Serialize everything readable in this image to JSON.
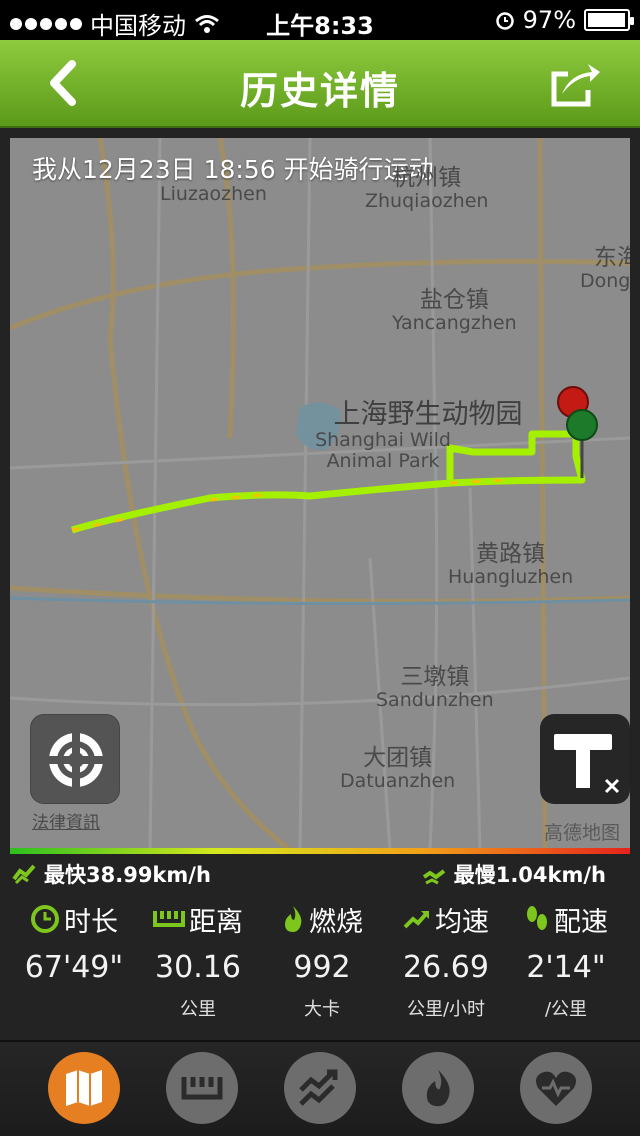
{
  "status_bar": {
    "carrier": "中国移动",
    "time": "上午8:33",
    "battery": "97%",
    "battery_level": 0.97
  },
  "nav": {
    "title": "历史详情",
    "back_icon": "chevron-left-icon",
    "share_icon": "share-icon"
  },
  "map": {
    "caption": "我从12月23日 18:56 开始骑行运动",
    "places": [
      {
        "zh": "",
        "en": "Liuzaozhen"
      },
      {
        "zh": "杭州镇",
        "en": "Zhuqiaozhen"
      },
      {
        "zh": "东海",
        "en": "Dongha"
      },
      {
        "zh": "盐仓镇",
        "en": "Yancangzhen"
      },
      {
        "zh": "上海野生动物园",
        "en": "Shanghai Wild Animal Park"
      },
      {
        "zh": "黄路镇",
        "en": "Huangluzhen"
      },
      {
        "zh": "三墩镇",
        "en": "Sandunzhen"
      },
      {
        "zh": "大团镇",
        "en": "Datuanzhen"
      }
    ],
    "legal_link": "法律資訊",
    "logo": "高德地图",
    "locate_icon": "locate-icon",
    "layer_icon": "toggle-track-icon"
  },
  "speed": {
    "fastest": "最快38.99km/h",
    "slowest": "最慢1.04km/h"
  },
  "stats": [
    {
      "label": "时长",
      "value": "67'49\"",
      "unit": "",
      "icon": "clock-icon"
    },
    {
      "label": "距离",
      "value": "30.16",
      "unit": "公里",
      "icon": "ruler-icon"
    },
    {
      "label": "燃烧",
      "value": "992",
      "unit": "大卡",
      "icon": "flame-icon"
    },
    {
      "label": "均速",
      "value": "26.69",
      "unit": "公里/小时",
      "icon": "trend-up-icon"
    },
    {
      "label": "配速",
      "value": "2'14\"",
      "unit": "/公里",
      "icon": "footprints-icon"
    }
  ],
  "tabs": [
    {
      "icon": "map-icon",
      "active": true
    },
    {
      "icon": "ruler-icon",
      "active": false
    },
    {
      "icon": "speed-chart-icon",
      "active": false
    },
    {
      "icon": "flame-icon",
      "active": false
    },
    {
      "icon": "heart-rate-icon",
      "active": false
    }
  ],
  "colors": {
    "accent": "#6aab24",
    "active_tab": "#e67e22",
    "route": "#a5f000",
    "stat_icon": "#7dc61e"
  }
}
